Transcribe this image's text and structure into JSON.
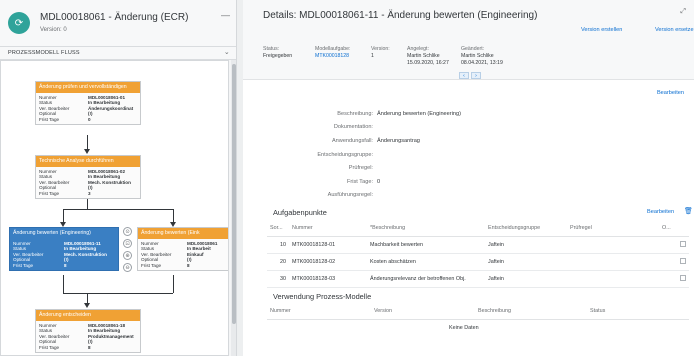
{
  "left": {
    "avatar_icon": "workflow-icon",
    "title": "MDL00018061 - Änderung (ECR)",
    "version": "Version: 0",
    "dash": "—",
    "subheader": "PROZESSMODELL FLUSS",
    "chevron": "⌄"
  },
  "nodes": {
    "n1": {
      "title": "Änderung prüfen und vervollständigen",
      "rows": [
        {
          "k": "Nummer",
          "v": "MDL00018061-01"
        },
        {
          "k": "Status",
          "v": "In Bearbeitung"
        },
        {
          "k": "Ver. Bearbeiter",
          "v": "Änderungskoordinat"
        },
        {
          "k": "Optional",
          "v": "(!)"
        },
        {
          "k": "Frist Tage",
          "v": "0"
        }
      ]
    },
    "n2": {
      "title": "Technische Analyse durchführen",
      "rows": [
        {
          "k": "Nummer",
          "v": "MDL00018061-02"
        },
        {
          "k": "Status",
          "v": "In Bearbeitung"
        },
        {
          "k": "Ver. Bearbeiter",
          "v": "Mech. Konstruktion"
        },
        {
          "k": "Optional",
          "v": "(!)"
        },
        {
          "k": "Frist Tage",
          "v": "3"
        }
      ]
    },
    "n3": {
      "title": "Änderung bewerten (Engineering)",
      "rows": [
        {
          "k": "Nummer",
          "v": "MDL00018061-11"
        },
        {
          "k": "Status",
          "v": "In Bearbeitung"
        },
        {
          "k": "Ver. Bearbeiter",
          "v": "Mech. Konstruktion"
        },
        {
          "k": "Optional",
          "v": "(!)"
        },
        {
          "k": "Frist Tage",
          "v": "8"
        }
      ]
    },
    "n4": {
      "title": "Änderung bewerten (Eink",
      "rows": [
        {
          "k": "Nummer",
          "v": "MDL00018061"
        },
        {
          "k": "Status",
          "v": "In Bearbeit"
        },
        {
          "k": "Ver. Bearbeiter",
          "v": "Einkauf"
        },
        {
          "k": "Optional",
          "v": "(!)"
        },
        {
          "k": "Frist Tage",
          "v": "8"
        }
      ]
    },
    "n5": {
      "title": "Änderung entscheiden",
      "rows": [
        {
          "k": "Nummer",
          "v": "MDL00018061-18"
        },
        {
          "k": "Status",
          "v": "In Bearbeitung"
        },
        {
          "k": "Ver. Bearbeiter",
          "v": "Produktmanagement"
        },
        {
          "k": "Optional",
          "v": "(!)"
        },
        {
          "k": "Frist Tage",
          "v": "8"
        }
      ]
    }
  },
  "canvas_controls": [
    "⊙",
    "⊡",
    "⊕",
    "⊖"
  ],
  "right": {
    "title": "Details: MDL00018061-11 - Änderung bewerten (Engineering)",
    "btn_version_create": "Version erstellen",
    "btn_version_replace": "Version ersetze",
    "icon_expand": "⤢",
    "meta": {
      "status_label": "Status:",
      "status_value": "Freigegeben",
      "task_label": "Modellaufgabe:",
      "task_value": "MTK00018128",
      "version_label": "Version:",
      "version_value": "1",
      "created_label": "Angelegt:",
      "created_by": "Martin Schlike",
      "created_at": "15.09.2020, 16:27",
      "changed_label": "Geändert:",
      "changed_by": "Martin Schlike",
      "changed_at": "08.04.2021, 13:19"
    },
    "nav_prev": "‹",
    "nav_next": "›",
    "edit": "Bearbeiten",
    "form": [
      {
        "label": "Beschreibung:",
        "value": "Änderung bewerten (Engineering)"
      },
      {
        "label": "Dokumentation:",
        "value": ""
      },
      {
        "label": "Anwendungsfall:",
        "value": "Änderungsantrag"
      },
      {
        "label": "Entscheidungsgruppe:",
        "value": ""
      },
      {
        "label": "Prüfregel:",
        "value": ""
      },
      {
        "label": "Frist Tage:",
        "value": "0"
      },
      {
        "label": "Ausführungsregel:",
        "value": ""
      }
    ],
    "tasks": {
      "title": "Aufgabenpunkte",
      "edit": "Bearbeiten",
      "trash_icon": "🗑",
      "headers": [
        "Sor...",
        "Nummer",
        "*Beschreibung",
        "Entscheidungsgruppe",
        "Prüfregel",
        "O..."
      ],
      "rows": [
        {
          "sort": "10",
          "number": "MTK00018128-01",
          "desc": "Machbarkeit bewerten",
          "group": "Jaftein",
          "rule": ""
        },
        {
          "sort": "20",
          "number": "MTK00018128-02",
          "desc": "Kosten abschätzen",
          "group": "Jaftein",
          "rule": ""
        },
        {
          "sort": "30",
          "number": "MTK00018128-03",
          "desc": "Änderungsrelevanz der betroffenen Obj.",
          "group": "Jaftein",
          "rule": ""
        }
      ]
    },
    "usage": {
      "title": "Verwendung Prozess-Modelle",
      "headers": [
        "Nummer",
        "Version",
        "Beschreibung",
        "Status"
      ],
      "no_data": "Keine Daten"
    }
  }
}
